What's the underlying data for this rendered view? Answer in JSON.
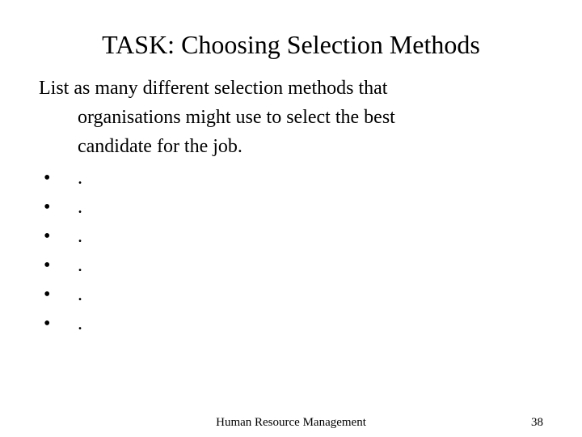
{
  "title": "TASK: Choosing Selection Methods",
  "body": {
    "line1": "List as many different selection methods that",
    "line2": "organisations might use to select the best",
    "line3": "candidate for the job."
  },
  "bullets": [
    ".",
    ".",
    ".",
    ".",
    ".",
    "."
  ],
  "bullet_char": "•",
  "footer": {
    "center": "Human Resource Management",
    "page": "38"
  }
}
